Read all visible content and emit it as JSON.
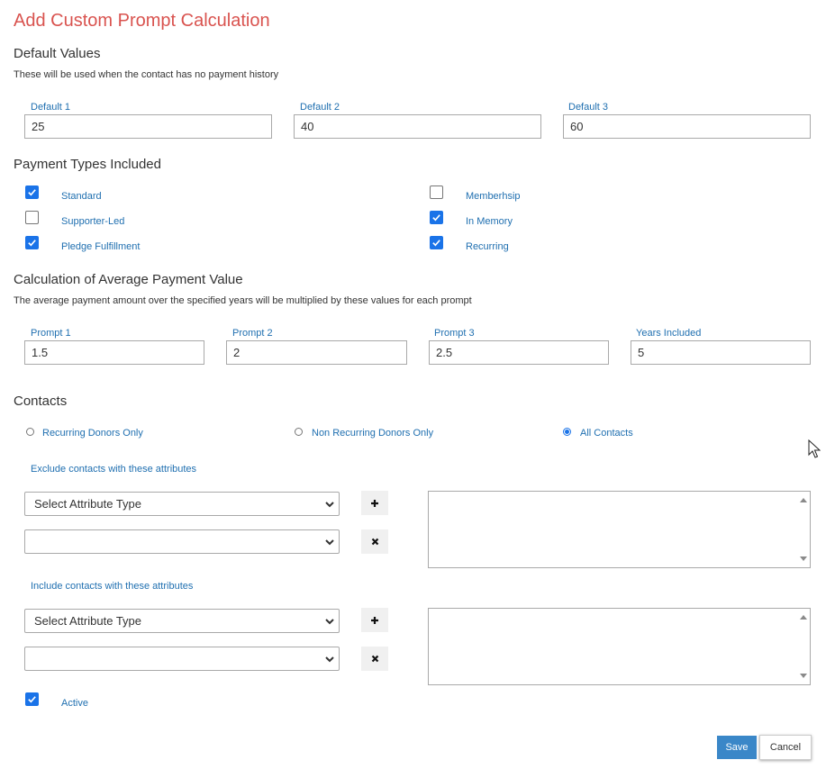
{
  "title": "Add Custom Prompt Calculation",
  "default_values": {
    "heading": "Default Values",
    "description": "These will be used when the contact has no payment history",
    "fields": [
      {
        "label": "Default 1",
        "value": "25"
      },
      {
        "label": "Default 2",
        "value": "40"
      },
      {
        "label": "Default 3",
        "value": "60"
      }
    ]
  },
  "payment_types": {
    "heading": "Payment Types Included",
    "items": [
      {
        "label": "Standard",
        "checked": true
      },
      {
        "label": "Memberhsip",
        "checked": false
      },
      {
        "label": "Supporter-Led",
        "checked": false
      },
      {
        "label": "In Memory",
        "checked": true
      },
      {
        "label": "Pledge Fulfillment",
        "checked": true
      },
      {
        "label": "Recurring",
        "checked": true
      }
    ]
  },
  "average_payment": {
    "heading": "Calculation of Average Payment Value",
    "description": "The average payment amount over the specified years will be multiplied by these values for each prompt",
    "fields": [
      {
        "label": "Prompt 1",
        "value": "1.5"
      },
      {
        "label": "Prompt 2",
        "value": "2"
      },
      {
        "label": "Prompt 3",
        "value": "2.5"
      },
      {
        "label": "Years Included",
        "value": "5"
      }
    ]
  },
  "contacts": {
    "heading": "Contacts",
    "options": [
      {
        "label": "Recurring Donors Only",
        "selected": false
      },
      {
        "label": "Non Recurring Donors Only",
        "selected": false
      },
      {
        "label": "All Contacts",
        "selected": true
      }
    ],
    "exclude": {
      "label": "Exclude contacts with these attributes",
      "type_select": "Select Attribute Type",
      "value_select": ""
    },
    "include": {
      "label": "Include contacts with these attributes",
      "type_select": "Select Attribute Type",
      "value_select": ""
    }
  },
  "active": {
    "label": "Active",
    "checked": true
  },
  "buttons": {
    "save": "Save",
    "cancel": "Cancel"
  },
  "colors": {
    "title": "#d9534f",
    "link_blue": "#1f6fb0",
    "checkbox": "#1a73e8",
    "save_button": "#3a87c8"
  },
  "icons": [
    "check-icon",
    "chevron-down-icon",
    "plus-icon",
    "remove-icon",
    "scroll-up-icon",
    "scroll-down-icon",
    "mouse-cursor-icon"
  ]
}
